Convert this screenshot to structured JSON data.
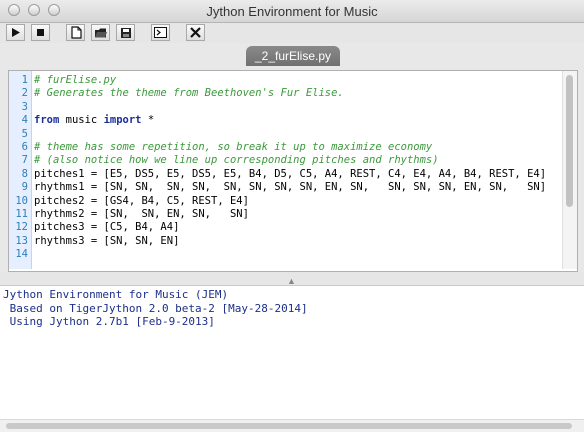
{
  "window": {
    "title": "Jython Environment for Music"
  },
  "tab": {
    "label": "_2_furElise.py"
  },
  "editor": {
    "lines": [
      {
        "n": "1",
        "parts": [
          {
            "t": "# furElise.py",
            "c": "comment"
          }
        ]
      },
      {
        "n": "2",
        "parts": [
          {
            "t": "# Generates the theme from Beethoven's Fur Elise.",
            "c": "comment"
          }
        ]
      },
      {
        "n": "3",
        "parts": []
      },
      {
        "n": "4",
        "parts": [
          {
            "t": "from",
            "c": "kw"
          },
          {
            "t": " music ",
            "c": ""
          },
          {
            "t": "import",
            "c": "kw"
          },
          {
            "t": " *",
            "c": ""
          }
        ]
      },
      {
        "n": "5",
        "parts": []
      },
      {
        "n": "6",
        "parts": [
          {
            "t": "# theme has some repetition, so break it up to maximize economy",
            "c": "comment"
          }
        ]
      },
      {
        "n": "7",
        "parts": [
          {
            "t": "# (also notice how we line up corresponding pitches and rhythms)",
            "c": "comment"
          }
        ]
      },
      {
        "n": "8",
        "parts": [
          {
            "t": "pitches1 = [E5, DS5, E5, DS5, E5, B4, D5, C5, A4, REST, C4, E4, A4, B4, REST, E4]",
            "c": ""
          }
        ]
      },
      {
        "n": "9",
        "parts": [
          {
            "t": "rhythms1 = [SN, SN,  SN, SN,  SN, SN, SN, SN, EN, SN,   SN, SN, SN, EN, SN,   SN]",
            "c": ""
          }
        ]
      },
      {
        "n": "10",
        "parts": [
          {
            "t": "pitches2 = [GS4, B4, C5, REST, E4]",
            "c": ""
          }
        ]
      },
      {
        "n": "11",
        "parts": [
          {
            "t": "rhythms2 = [SN,  SN, EN, SN,   SN]",
            "c": ""
          }
        ]
      },
      {
        "n": "12",
        "parts": [
          {
            "t": "pitches3 = [C5, B4, A4]",
            "c": ""
          }
        ]
      },
      {
        "n": "13",
        "parts": [
          {
            "t": "rhythms3 = [SN, SN, EN]",
            "c": ""
          }
        ]
      },
      {
        "n": "14",
        "parts": []
      }
    ]
  },
  "console": {
    "lines": [
      "Jython Environment for Music (JEM)",
      " Based on TigerJython 2.0 beta-2 [May-28-2014]",
      " Using Jython 2.7b1 [Feb-9-2013]"
    ]
  },
  "toolbar": {
    "buttons": [
      {
        "name": "run-button",
        "icon": "play-icon"
      },
      {
        "name": "stop-button",
        "icon": "stop-icon"
      },
      {
        "name": "new-file-button",
        "icon": "new-file-icon"
      },
      {
        "name": "open-file-button",
        "icon": "folder-icon"
      },
      {
        "name": "save-file-button",
        "icon": "save-icon"
      },
      {
        "name": "terminal-button",
        "icon": "terminal-icon"
      },
      {
        "name": "tools-button",
        "icon": "tools-icon"
      }
    ]
  }
}
